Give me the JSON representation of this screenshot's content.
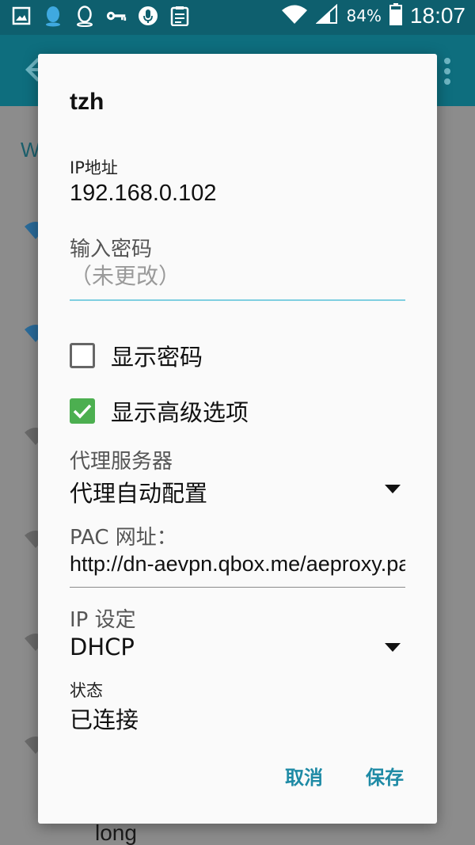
{
  "status_bar": {
    "left_icons": [
      "gallery-icon",
      "qq-icon",
      "qq-outline-icon",
      "key-icon",
      "mic-icon",
      "clipboard-icon"
    ],
    "battery_percent": "84%",
    "time": "18:07"
  },
  "background": {
    "section_letter": "W",
    "partial_item_text": "long"
  },
  "dialog": {
    "title": "tzh",
    "ip": {
      "label": "IP地址",
      "value": "192.168.0.102"
    },
    "password": {
      "label": "输入密码",
      "placeholder": "（未更改）",
      "value": ""
    },
    "show_password": {
      "label": "显示密码",
      "checked": false
    },
    "show_advanced": {
      "label": "显示高级选项",
      "checked": true
    },
    "proxy": {
      "label": "代理服务器",
      "value": "代理自动配置"
    },
    "pac": {
      "label": "PAC 网址：",
      "value": "http://dn-aevpn.qbox.me/aeproxy.pac"
    },
    "ip_settings": {
      "label": "IP 设定",
      "value": "DHCP"
    },
    "status": {
      "label": "状态",
      "value": "已连接"
    },
    "buttons": {
      "cancel": "取消",
      "save": "保存"
    }
  },
  "colors": {
    "accent": "#1e8aa5",
    "checkbox_checked": "#4caf50",
    "input_focus_line": "#7fcfe0",
    "status_bar": "#0e5f6e",
    "app_bar": "#0e6e7e"
  }
}
